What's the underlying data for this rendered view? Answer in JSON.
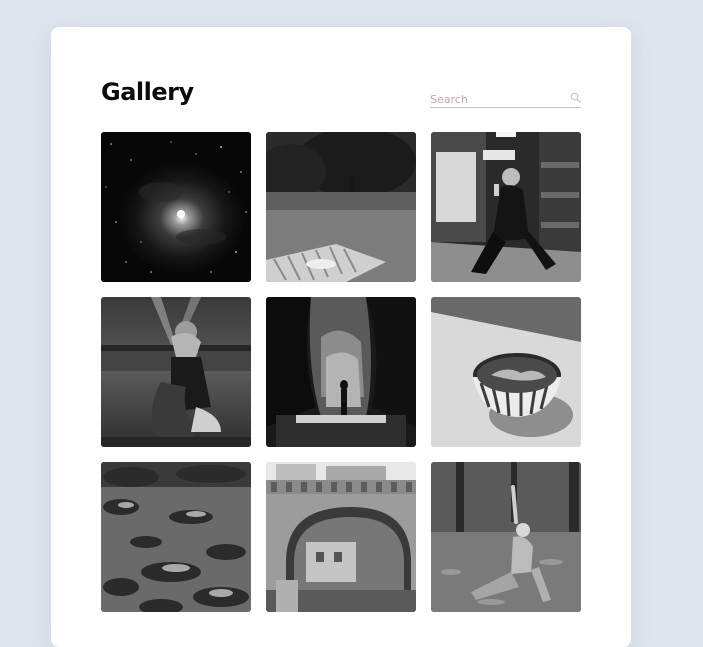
{
  "gallery": {
    "title": "Gallery",
    "search": {
      "placeholder": "Search",
      "value": "",
      "icon": "search-icon"
    },
    "photos": [
      {
        "name": "photo-nebula"
      },
      {
        "name": "photo-park-picnic"
      },
      {
        "name": "photo-woman-store-aisle"
      },
      {
        "name": "photo-woman-parking-lot"
      },
      {
        "name": "photo-canyon-figure"
      },
      {
        "name": "photo-striped-bowl"
      },
      {
        "name": "photo-rocky-shore"
      },
      {
        "name": "photo-stone-arch-bridge"
      },
      {
        "name": "photo-woman-forest-pose"
      }
    ]
  }
}
